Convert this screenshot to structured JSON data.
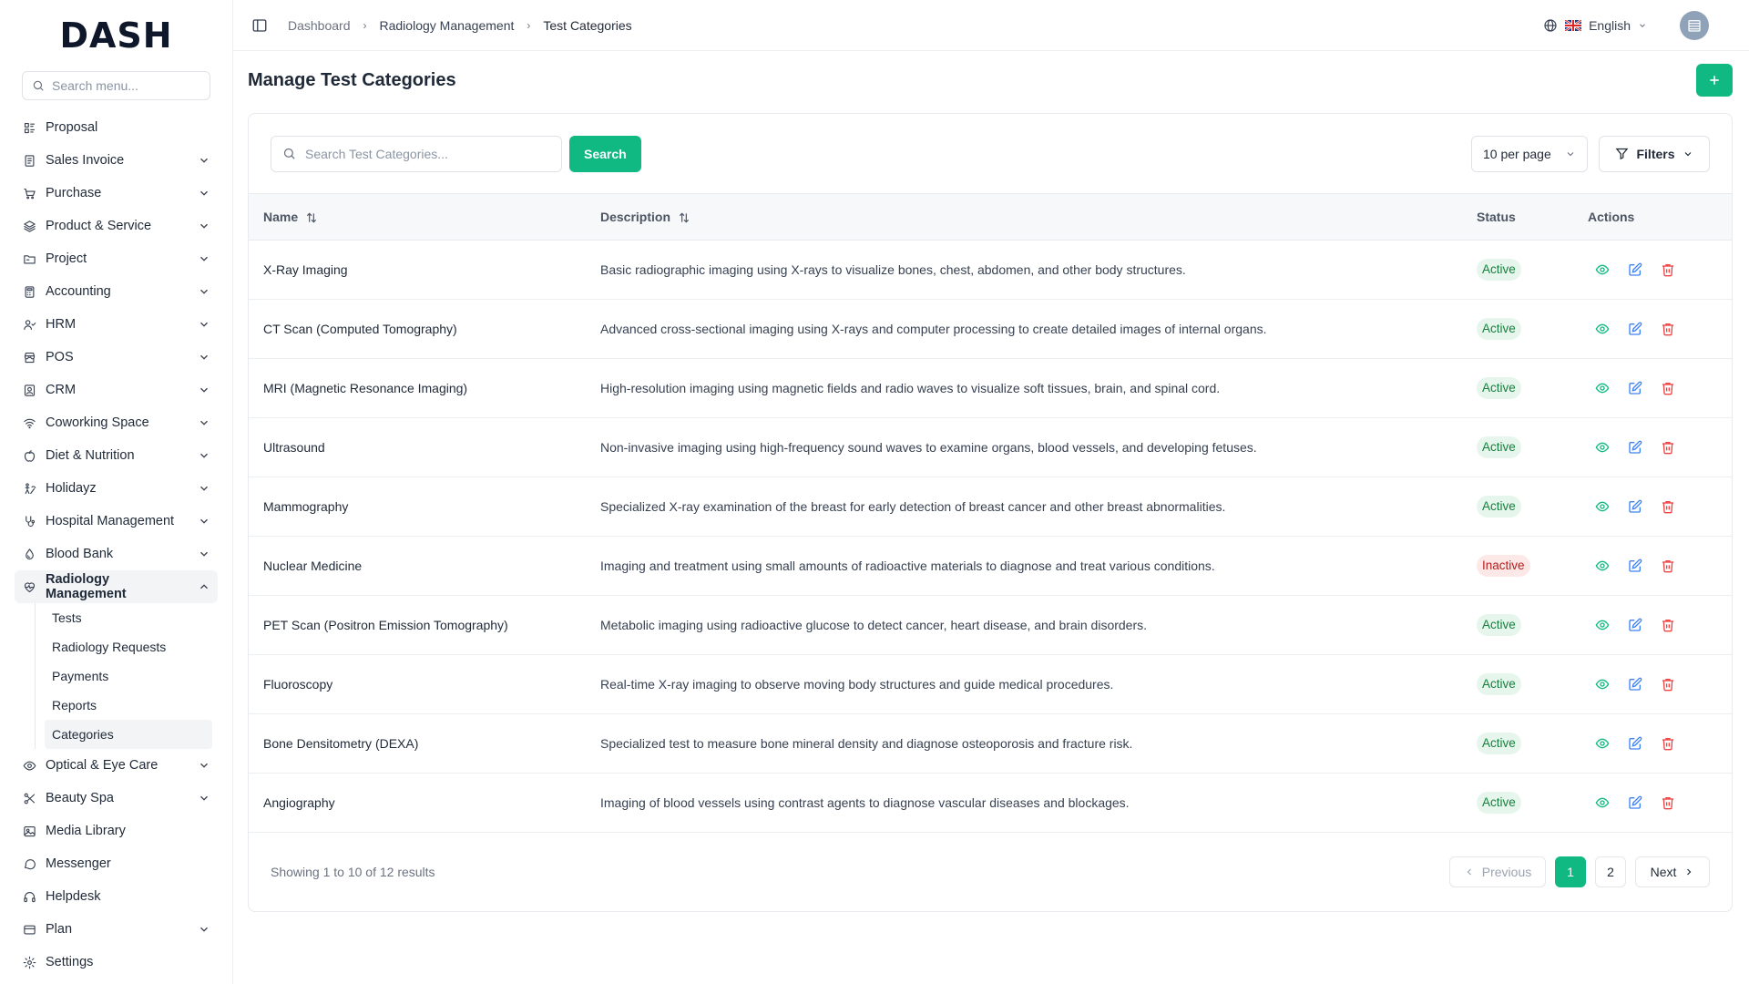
{
  "brand": {
    "logo_text": "DASH"
  },
  "sidebar": {
    "search_placeholder": "Search menu...",
    "items": [
      {
        "label": "Proposal",
        "icon": "proposal-icon",
        "chevron": false
      },
      {
        "label": "Sales Invoice",
        "icon": "invoice-icon",
        "chevron": true
      },
      {
        "label": "Purchase",
        "icon": "cart-icon",
        "chevron": true
      },
      {
        "label": "Product & Service",
        "icon": "layers-icon",
        "chevron": true
      },
      {
        "label": "Project",
        "icon": "folder-icon",
        "chevron": true
      },
      {
        "label": "Accounting",
        "icon": "calculator-icon",
        "chevron": true
      },
      {
        "label": "HRM",
        "icon": "users-icon",
        "chevron": true
      },
      {
        "label": "POS",
        "icon": "store-icon",
        "chevron": true
      },
      {
        "label": "CRM",
        "icon": "contact-icon",
        "chevron": true
      },
      {
        "label": "Coworking Space",
        "icon": "wifi-icon",
        "chevron": true
      },
      {
        "label": "Diet & Nutrition",
        "icon": "apple-icon",
        "chevron": true
      },
      {
        "label": "Holidayz",
        "icon": "holiday-icon",
        "chevron": true
      },
      {
        "label": "Hospital Management",
        "icon": "stethoscope-icon",
        "chevron": true
      },
      {
        "label": "Blood Bank",
        "icon": "drop-icon",
        "chevron": true
      },
      {
        "label": "Radiology Management",
        "icon": "heart-pulse-icon",
        "chevron": true,
        "active": true
      },
      {
        "label": "Optical & Eye Care",
        "icon": "eye-icon",
        "chevron": true
      },
      {
        "label": "Beauty Spa",
        "icon": "scissors-icon",
        "chevron": true
      },
      {
        "label": "Media Library",
        "icon": "image-icon",
        "chevron": false
      },
      {
        "label": "Messenger",
        "icon": "chat-icon",
        "chevron": false
      },
      {
        "label": "Helpdesk",
        "icon": "headset-icon",
        "chevron": false
      },
      {
        "label": "Plan",
        "icon": "card-icon",
        "chevron": true
      },
      {
        "label": "Settings",
        "icon": "gear-icon",
        "chevron": false
      }
    ],
    "radiology_sub": [
      "Tests",
      "Radiology Requests",
      "Payments",
      "Reports",
      "Categories"
    ]
  },
  "topbar": {
    "breadcrumbs": [
      "Dashboard",
      "Radiology Management",
      "Test Categories"
    ],
    "language": "English"
  },
  "page": {
    "title": "Manage Test Categories",
    "search_placeholder": "Search Test Categories...",
    "search_button": "Search",
    "per_page": "10 per page",
    "filters_label": "Filters"
  },
  "table": {
    "headers": {
      "name": "Name",
      "description": "Description",
      "status": "Status",
      "actions": "Actions"
    },
    "rows": [
      {
        "name": "X-Ray Imaging",
        "description": "Basic radiographic imaging using X-rays to visualize bones, chest, abdomen, and other body structures.",
        "status": "Active"
      },
      {
        "name": "CT Scan (Computed Tomography)",
        "description": "Advanced cross-sectional imaging using X-rays and computer processing to create detailed images of internal organs.",
        "status": "Active"
      },
      {
        "name": "MRI (Magnetic Resonance Imaging)",
        "description": "High-resolution imaging using magnetic fields and radio waves to visualize soft tissues, brain, and spinal cord.",
        "status": "Active"
      },
      {
        "name": "Ultrasound",
        "description": "Non-invasive imaging using high-frequency sound waves to examine organs, blood vessels, and developing fetuses.",
        "status": "Active"
      },
      {
        "name": "Mammography",
        "description": "Specialized X-ray examination of the breast for early detection of breast cancer and other breast abnormalities.",
        "status": "Active"
      },
      {
        "name": "Nuclear Medicine",
        "description": "Imaging and treatment using small amounts of radioactive materials to diagnose and treat various conditions.",
        "status": "Inactive"
      },
      {
        "name": "PET Scan (Positron Emission Tomography)",
        "description": "Metabolic imaging using radioactive glucose to detect cancer, heart disease, and brain disorders.",
        "status": "Active"
      },
      {
        "name": "Fluoroscopy",
        "description": "Real-time X-ray imaging to observe moving body structures and guide medical procedures.",
        "status": "Active"
      },
      {
        "name": "Bone Densitometry (DEXA)",
        "description": "Specialized test to measure bone mineral density and diagnose osteoporosis and fracture risk.",
        "status": "Active"
      },
      {
        "name": "Angiography",
        "description": "Imaging of blood vessels using contrast agents to diagnose vascular diseases and blockages.",
        "status": "Active"
      }
    ]
  },
  "pagination": {
    "info": "Showing 1 to 10 of 12 results",
    "previous": "Previous",
    "next": "Next",
    "pages": [
      "1",
      "2"
    ],
    "current": "1"
  },
  "colors": {
    "accent": "#10b981",
    "active_badge_bg": "#e7f6ec",
    "inactive_badge_bg": "#fde8e8",
    "view_icon": "#10b981",
    "edit_icon": "#3b82f6",
    "delete_icon": "#ef4444"
  }
}
